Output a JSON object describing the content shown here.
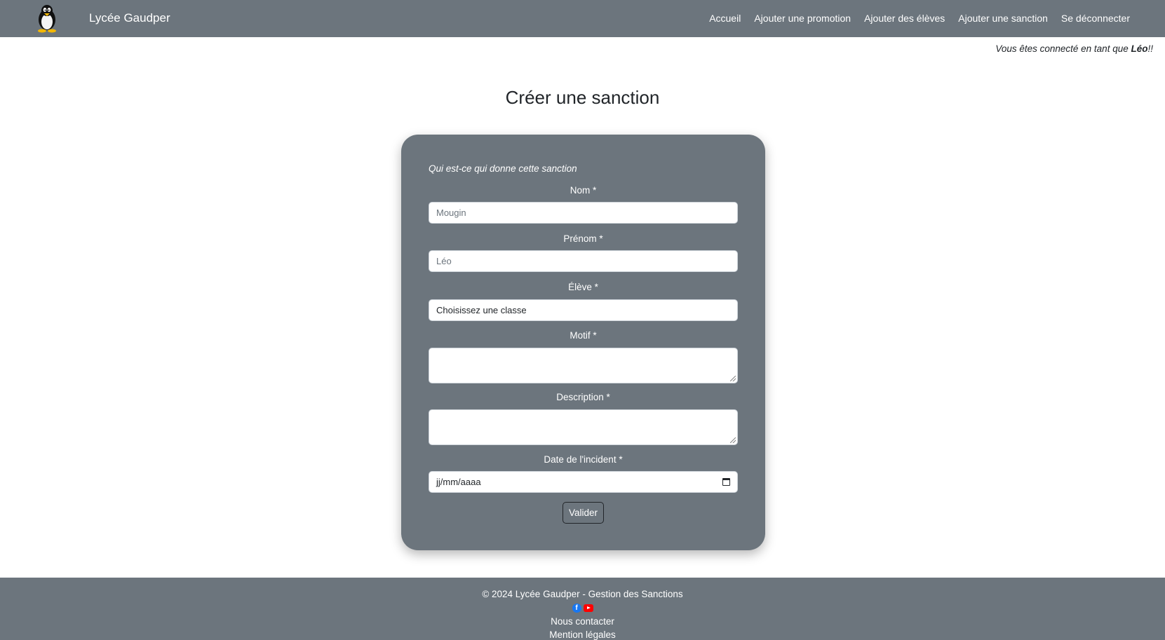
{
  "navbar": {
    "brand": "Lycée Gaudper",
    "links": [
      "Accueil",
      "Ajouter une promotion",
      "Ajouter des élèves",
      "Ajouter une sanction",
      "Se déconnecter"
    ]
  },
  "welcome": {
    "prefix": "Vous êtes connecté en tant que ",
    "user": "Léo",
    "suffix": "!!"
  },
  "page": {
    "title": "Créer une sanction"
  },
  "form": {
    "intro": "Qui est-ce qui donne cette sanction",
    "nom": {
      "label": "Nom *",
      "placeholder": "Mougin"
    },
    "prenom": {
      "label": "Prénom *",
      "placeholder": "Léo"
    },
    "eleve": {
      "label": "Élève *",
      "value": "Choisissez une classe"
    },
    "motif": {
      "label": "Motif *"
    },
    "description": {
      "label": "Description *"
    },
    "date": {
      "label": "Date de l'incident *",
      "placeholder": "jj/mm/aaaa"
    },
    "submit": "Valider"
  },
  "footer": {
    "copyright": "© 2024 Lycée Gaudper - Gestion des Sanctions",
    "facebook_icon": "f",
    "contact": "Nous contacter",
    "legal": "Mention légales"
  }
}
